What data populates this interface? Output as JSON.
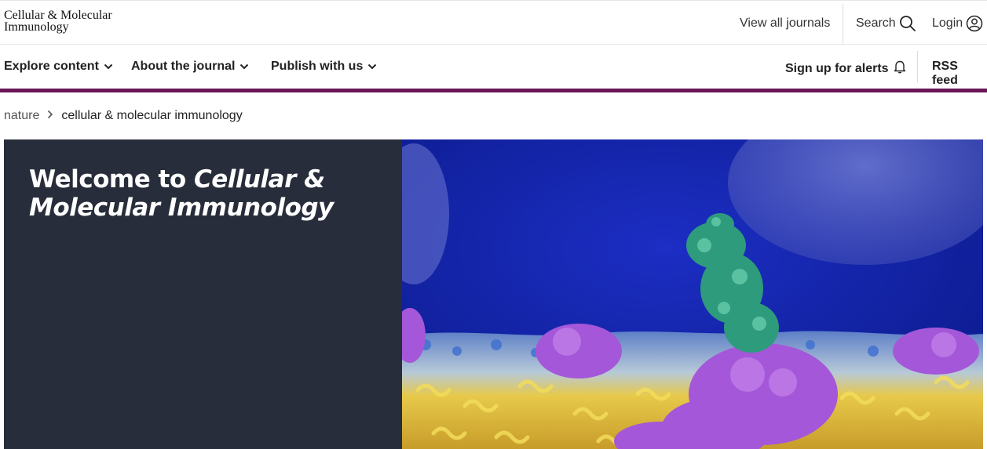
{
  "header": {
    "logo_line1": "Cellular & Molecular",
    "logo_line2": "Immunology",
    "view_all_journals": "View all journals",
    "search": "Search",
    "login": "Login"
  },
  "nav": {
    "explore": "Explore content",
    "about": "About the journal",
    "publish": "Publish with us",
    "alerts": "Sign up for alerts",
    "rss": "RSS feed"
  },
  "breadcrumb": {
    "home": "nature",
    "current": "cellular & molecular immunology"
  },
  "hero": {
    "title_prefix": "Welcome to ",
    "title_italic": "Cellular & Molecular Immunology"
  },
  "colors": {
    "accent_bar": "#6b1659",
    "hero_panel": "#272d3a"
  }
}
